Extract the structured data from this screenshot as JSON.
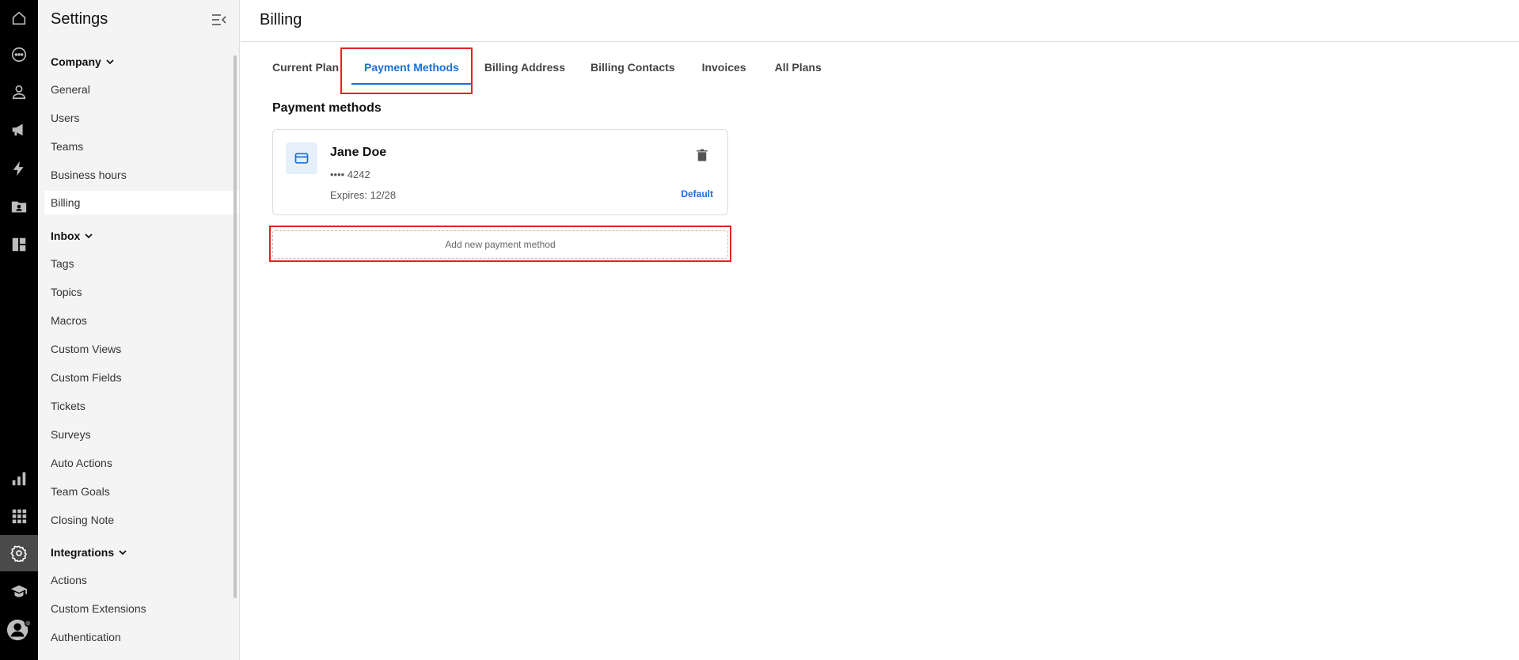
{
  "rail": {
    "top_icons": [
      "home-icon",
      "chat-icon",
      "person-icon",
      "megaphone-icon",
      "lightning-icon",
      "contact-folder-icon",
      "dashboard-icon"
    ],
    "bottom_icons": [
      "bar-chart-icon",
      "apps-grid-icon",
      "gear-icon",
      "graduation-cap-icon",
      "avatar-icon"
    ],
    "active": "gear-icon"
  },
  "sidebar": {
    "title": "Settings",
    "sections": [
      {
        "label": "Company",
        "items": [
          "General",
          "Users",
          "Teams",
          "Business hours",
          "Billing"
        ]
      },
      {
        "label": "Inbox",
        "items": [
          "Tags",
          "Topics",
          "Macros",
          "Custom Views",
          "Custom Fields",
          "Tickets",
          "Surveys",
          "Auto Actions",
          "Team Goals",
          "Closing Note"
        ]
      },
      {
        "label": "Integrations",
        "items": [
          "Actions",
          "Custom Extensions",
          "Authentication"
        ]
      }
    ],
    "active_item": "Billing"
  },
  "main": {
    "title": "Billing",
    "tabs": [
      "Current Plan",
      "Payment Methods",
      "Billing Address",
      "Billing Contacts",
      "Invoices",
      "All Plans"
    ],
    "active_tab": "Payment Methods",
    "section_title": "Payment methods",
    "card": {
      "name": "Jane Doe",
      "number": "•••• 4242",
      "expiry": "Expires: 12/28",
      "default_label": "Default"
    },
    "add_button": "Add new payment method"
  },
  "colors": {
    "accent": "#1d6fd6",
    "highlight": "#e32420",
    "rail_bg": "#000000",
    "sidebar_bg": "#f4f4f4"
  }
}
